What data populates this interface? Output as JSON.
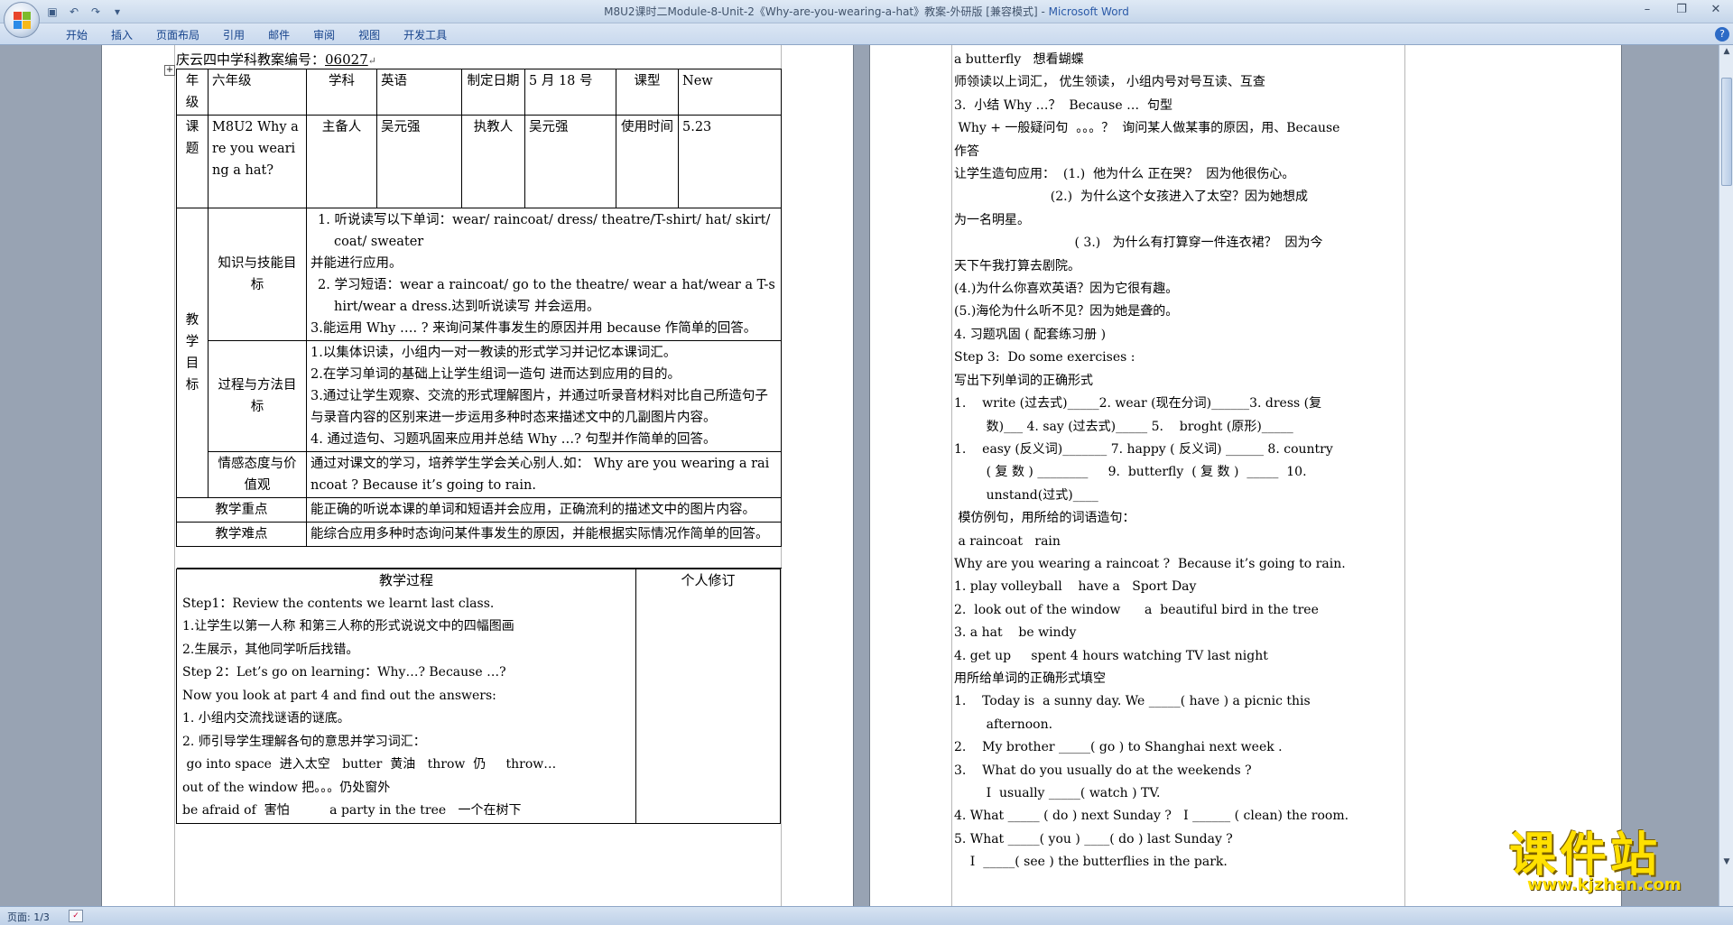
{
  "window": {
    "title_doc": "M8U2课时二Module-8-Unit-2《Why-are-you-wearing-a-hat》教案-外研版 [兼容模式] - ",
    "title_app": "Microsoft Word",
    "controls": [
      "–",
      "❐",
      "✕"
    ]
  },
  "qat": {
    "icons": [
      "save-icon",
      "undo-icon",
      "redo-icon",
      "customize-icon"
    ]
  },
  "tabs": [
    "开始",
    "插入",
    "页面布局",
    "引用",
    "邮件",
    "审阅",
    "视图",
    "开发工具"
  ],
  "page1": {
    "header_prefix": "庆云四中学科教案编号：",
    "header_number": "06027",
    "row1": {
      "grade_label": "年级",
      "grade": "六年级",
      "subject_label": "学科",
      "subject": "英语",
      "date_label": "制定日期",
      "date": "5 月 18 号",
      "type_label": "课型",
      "type": "New"
    },
    "row2": {
      "topic_label": "课题",
      "topic": "M8U2 Why are you wearing a hat?",
      "preparer_label": "主备人",
      "preparer": "吴元强",
      "teacher_label": "执教人",
      "teacher": "吴元强",
      "use_label": "使用时间",
      "use_time": "5.23"
    },
    "goals_label": "教学目标",
    "knowledge_label": "知识与技能目标",
    "knowledge": [
      "1.  听说读写以下单词：wear/ raincoat/ dress/ theatre/T-shirt/ hat/ skirt/ coat/ sweater",
      "并能进行应用。",
      "2.  学习短语：wear a raincoat/ go to the theatre/ wear a hat/wear a T-shirt/wear a dress.达到听说读写 并会运用。",
      "3.能运用 Why …. ? 来询问某件事发生的原因并用 because  作简单的回答。"
    ],
    "process_label": "过程与方法目标",
    "process": [
      "1.以集体识读，小组内一对一教读的形式学习并记忆本课词汇。",
      "2.在学习单词的基础上让学生组词一造句 进而达到应用的目的。",
      "3.通过让学生观察、交流的形式理解图片，并通过听录音材料对比自己所造句子与录音内容的区别来进一步运用多种时态来描述文中的几副图片内容。",
      "4.  通过造句、习题巩固来应用并总结 Why …? 句型并作简单的回答。"
    ],
    "emotion_label": "情感态度与价值观",
    "emotion": "通过对课文的学习，培养学生学会关心别人.如：  Why are you wearing a raincoat ? Because it’s going to rain.",
    "key_label": "教学重点",
    "key": "能正确的听说本课的单词和短语并会应用，正确流利的描述文中的图片内容。",
    "diff_label": "教学难点",
    "diff": "能综合应用多种时态询问某件事发生的原因，并能根据实际情况作简单的回答。",
    "proc_head": "教学过程",
    "edit_head": "个人修订",
    "proc_lines": [
      "Step1：Review the contents we learnt last class.",
      "1.让学生以第一人称 和第三人称的形式说说文中的四幅图画",
      "2.生展示，其他同学听后找错。",
      "Step 2：Let’s go on learning：Why…?  Because …?",
      "Now you look at part 4 and find out the answers:",
      "1.  小组内交流找谜语的谜底。",
      "2.  师引导学生理解各句的意思并学习词汇：",
      " go into space  进入太空   butter  黄油   throw  仍     throw…",
      "out of the window   把。。。仍处窗外",
      "be afraid of  害怕          a party in the tree   一个在树下"
    ]
  },
  "page2": {
    "lines": [
      "a butterfly   想看蝴蝶",
      "师领读以上词汇， 优生领读， 小组内号对号互读、互查",
      "3.  小结 Why …？  Because …  句型",
      " Why + 一般疑问句  。。。？  询问某人做某事的原因，用、Because",
      "作答",
      "让学生造句应用：  (1.)  他为什么 正在哭？  因为他很伤心。",
      "                        (2.)  为什么这个女孩进入了太空？因为她想成",
      "为一名明星。",
      "                              ( 3.)   为什么有打算穿一件连衣裙？  因为今",
      "天下午我打算去剧院。",
      "(4.)为什么你喜欢英语？因为它很有趣。",
      "(5.)海伦为什么听不见？因为她是聋的。",
      "4. 习题巩固 ( 配套练习册 )",
      "Step 3:  Do some exercises :",
      "写出下列单词的正确形式",
      "1.    write (过去式)_____2. wear (现在分词)______3. dress (复",
      "        数)___ 4. say (过去式)_____ 5.    broght (原形)_____",
      "1.    easy (反义词)_______ 7. happy ( 反义词) ______ 8. country",
      "        ( 复 数 ) ________     9.  butterfly  ( 复 数 )  _____  10.",
      "        unstand(过式)____",
      " 模仿例句，用所给的词语造句：",
      " a raincoat   rain",
      "Why are you wearing a raincoat ?  Because it’s going to rain.",
      "1. play volleyball    have a   Sport Day",
      "2.  look out of the window      a  beautiful bird in the tree",
      "3. a hat    be windy",
      "4. get up     spent 4 hours watching TV last night",
      "用所给单词的正确形式填空",
      "1.    Today is  a sunny day. We _____( have ) a picnic this",
      "        afternoon.",
      "2.    My brother _____( go ) to Shanghai next week .",
      "3.    What do you usually do at the weekends ?",
      "        I  usually _____( watch ) TV.",
      "4. What _____ ( do ) next Sunday ?   I ______ ( clean) the room.",
      "5. What _____( you ) ____( do ) last Sunday ?",
      "    I  _____( see ) the butterflies in the park.",
      "",
      ""
    ]
  },
  "watermark": {
    "title": "课件站",
    "url": "www.kjzhan.com"
  },
  "status": {
    "page": "页面: 1/3"
  }
}
